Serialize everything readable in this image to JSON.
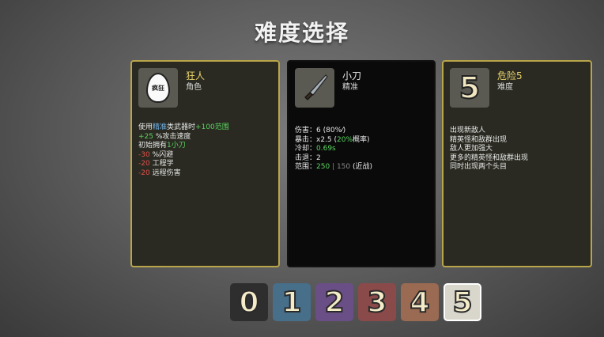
{
  "title": "难度选择",
  "character": {
    "name": "狂人",
    "type": "角色",
    "icon": "egg-character-icon",
    "icon_text": "疯狂",
    "lines": [
      [
        {
          "t": "使用",
          "c": ""
        },
        {
          "t": "精准",
          "c": "blue"
        },
        {
          "t": "类武器时",
          "c": ""
        },
        {
          "t": "+100范围",
          "c": "green"
        }
      ],
      [
        {
          "t": "+25",
          "c": "green"
        },
        {
          "t": " %攻击速度",
          "c": ""
        }
      ],
      [
        {
          "t": "初始拥有",
          "c": ""
        },
        {
          "t": "1小刀",
          "c": "green"
        }
      ],
      [
        {
          "t": "-30",
          "c": "red"
        },
        {
          "t": " %闪避",
          "c": ""
        }
      ],
      [
        {
          "t": "-20",
          "c": "red"
        },
        {
          "t": " 工程学",
          "c": ""
        }
      ],
      [
        {
          "t": "-20",
          "c": "red"
        },
        {
          "t": " 远程伤害",
          "c": ""
        }
      ]
    ]
  },
  "weapon": {
    "name": "小刀",
    "type": "精准",
    "icon": "knife-icon",
    "lines": [
      [
        {
          "t": "伤害：",
          "c": ""
        },
        {
          "t": "6 (80%",
          "c": ""
        },
        {
          "t": "⁄",
          "c": ""
        },
        {
          "t": ")",
          "c": ""
        }
      ],
      [
        {
          "t": "暴击：",
          "c": ""
        },
        {
          "t": "x2.5",
          "c": ""
        },
        {
          "t": " (",
          "c": ""
        },
        {
          "t": "20%",
          "c": "green"
        },
        {
          "t": "概率)",
          "c": ""
        }
      ],
      [
        {
          "t": "冷却：",
          "c": ""
        },
        {
          "t": "0.69s",
          "c": "green"
        }
      ],
      [
        {
          "t": "击退：",
          "c": ""
        },
        {
          "t": "2",
          "c": ""
        }
      ],
      [
        {
          "t": "范围：",
          "c": ""
        },
        {
          "t": "250",
          "c": "green"
        },
        {
          "t": " | 150",
          "c": "grey"
        },
        {
          "t": "  (近战)",
          "c": ""
        }
      ]
    ]
  },
  "danger": {
    "name": "危险5",
    "type": "难度",
    "icon_text": "5",
    "lines": [
      "出现新敌人",
      "精英怪和敌群出现",
      "敌人更加强大",
      "更多的精英怪和敌群出现",
      "同时出现两个头目"
    ]
  },
  "difficulties": [
    {
      "label": "0",
      "color": "#2e2e2e"
    },
    {
      "label": "1",
      "color": "#476f8a"
    },
    {
      "label": "2",
      "color": "#6a4e86"
    },
    {
      "label": "3",
      "color": "#8a4a4a"
    },
    {
      "label": "4",
      "color": "#9a6a52"
    },
    {
      "label": "5",
      "color": "#d9d6cc"
    }
  ],
  "selected_difficulty": "5"
}
